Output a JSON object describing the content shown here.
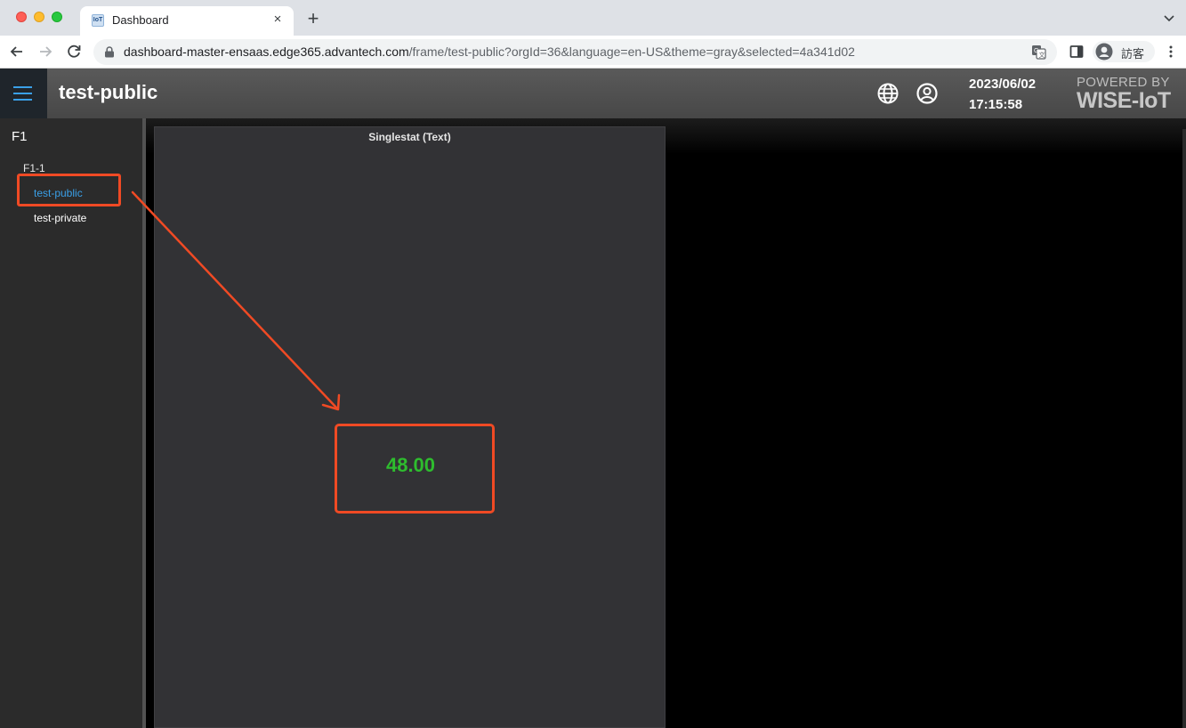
{
  "browser": {
    "tab_title": "Dashboard",
    "tab_favicon_text": "IoT",
    "url_host": "dashboard-master-ensaas.edge365.advantech.com",
    "url_rest": "/frame/test-public?orgId=36&language=en-US&theme=gray&selected=4a341d02",
    "profile_label": "訪客",
    "new_tab_symbol": "+",
    "close_symbol": "×"
  },
  "header": {
    "title": "test-public",
    "date": "2023/06/02",
    "time": "17:15:58",
    "powered_by": "POWERED BY",
    "brand": "WISE-IoT",
    "accent_color": "#3aa0e8"
  },
  "sidebar": {
    "group": "F1",
    "subgroup": "F1-1",
    "items": [
      {
        "label": "test-public",
        "active": true
      },
      {
        "label": "test-private",
        "active": false
      }
    ]
  },
  "panel": {
    "title": "Singlestat (Text)",
    "value": "48.00",
    "value_color": "#2ebd2e"
  },
  "annotation": {
    "color": "#f04a24"
  }
}
